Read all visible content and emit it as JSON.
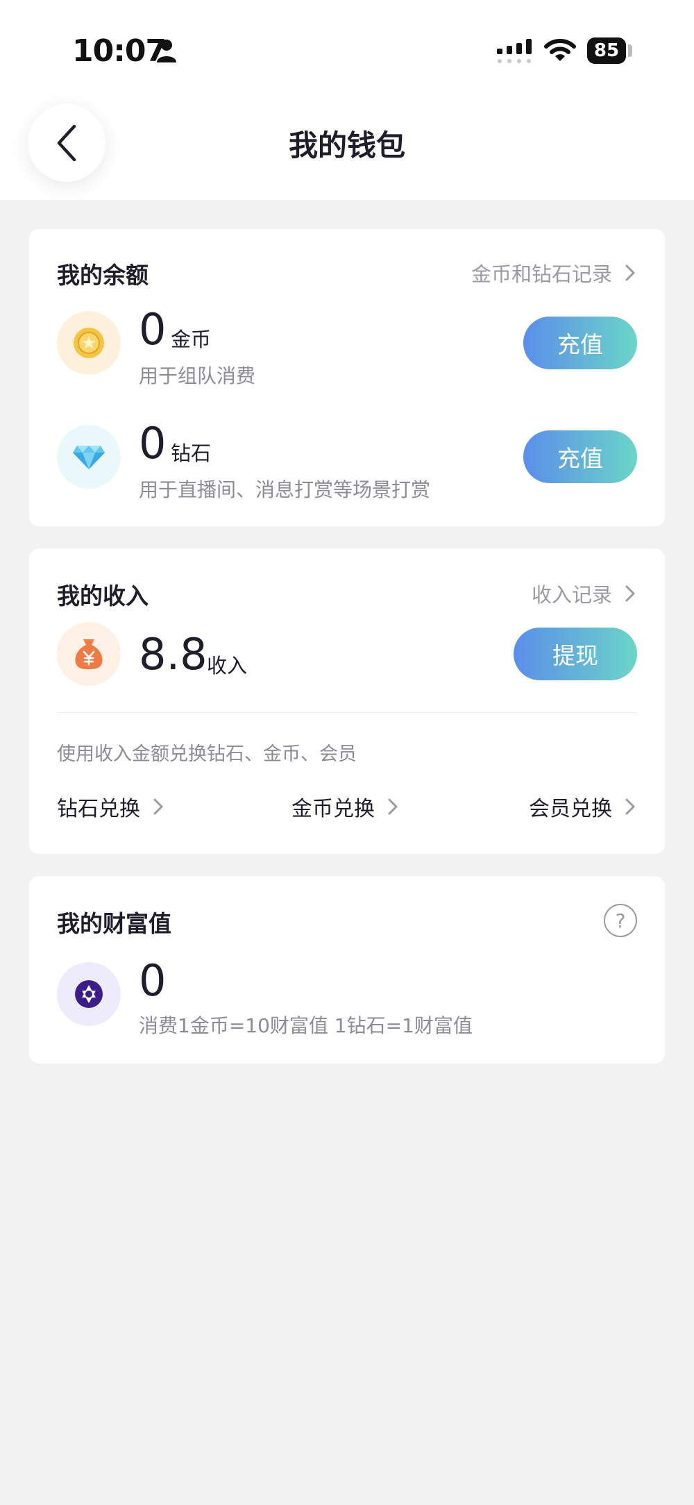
{
  "status_bar": {
    "time": "10:07",
    "battery": "85"
  },
  "header": {
    "title": "我的钱包"
  },
  "balance": {
    "title": "我的余额",
    "record_link": "金币和钻石记录",
    "coin": {
      "amount": "0",
      "unit": "金币",
      "desc": "用于组队消费",
      "button": "充值"
    },
    "diamond": {
      "amount": "0",
      "unit": "钻石",
      "desc": "用于直播间、消息打赏等场景打赏",
      "button": "充值"
    }
  },
  "income": {
    "title": "我的收入",
    "record_link": "收入记录",
    "amount": "8.8",
    "unit": "收入",
    "button": "提现",
    "exchange_hint": "使用收入金额兑换钻石、金币、会员",
    "exchanges": [
      "钻石兑换",
      "金币兑换",
      "会员兑换"
    ]
  },
  "wealth": {
    "title": "我的财富值",
    "help": "?",
    "amount": "0",
    "desc": "消费1金币=10财富值 1钻石=1财富值"
  },
  "colors": {
    "accent_gradient_start": "#5b8ee9",
    "accent_gradient_end": "#6ad5c8",
    "background": "#f2f2f3"
  }
}
